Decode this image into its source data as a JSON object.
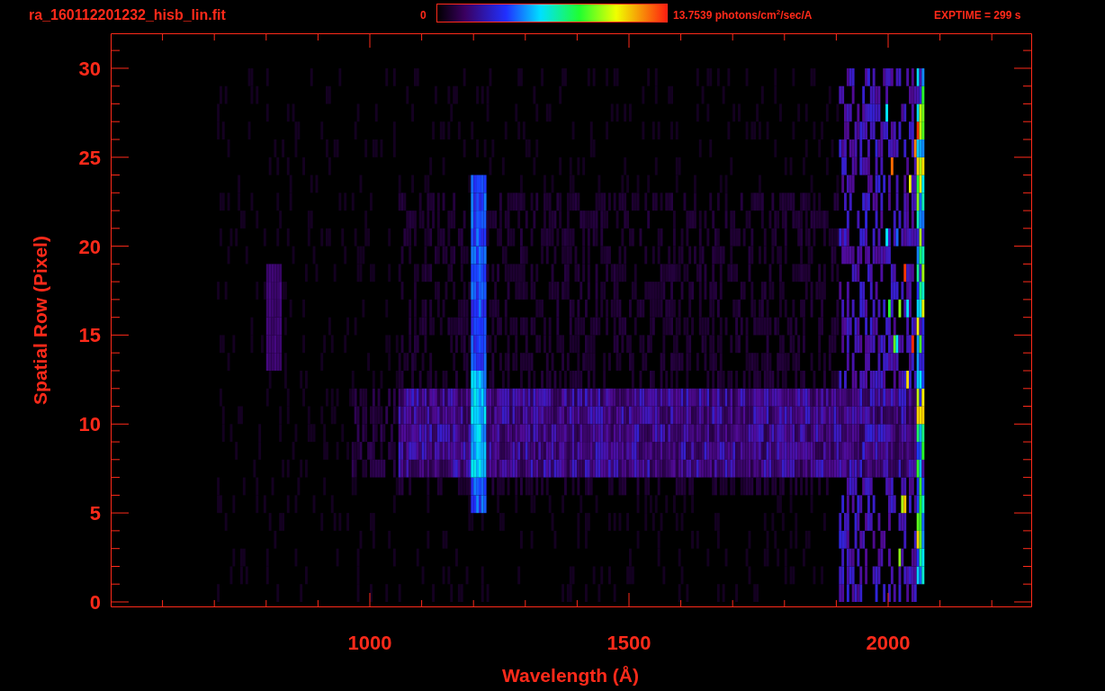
{
  "header": {
    "filename": "ra_160112201232_hisb_lin.fit",
    "colorbar": {
      "min_label": "0",
      "max_label": "13.7539 photons/cm$^{2}$/sec/A"
    },
    "exposure": "EXPTIME = 299 s"
  },
  "plot": {
    "xlabel": "Wavelength (Å)",
    "ylabel": "Spatial Row (Pixel)",
    "xtick_labels": [
      "1000",
      "1500",
      "2000"
    ],
    "ytick_labels": [
      "30",
      "25",
      "20",
      "15",
      "10",
      "5",
      "0"
    ]
  }
}
